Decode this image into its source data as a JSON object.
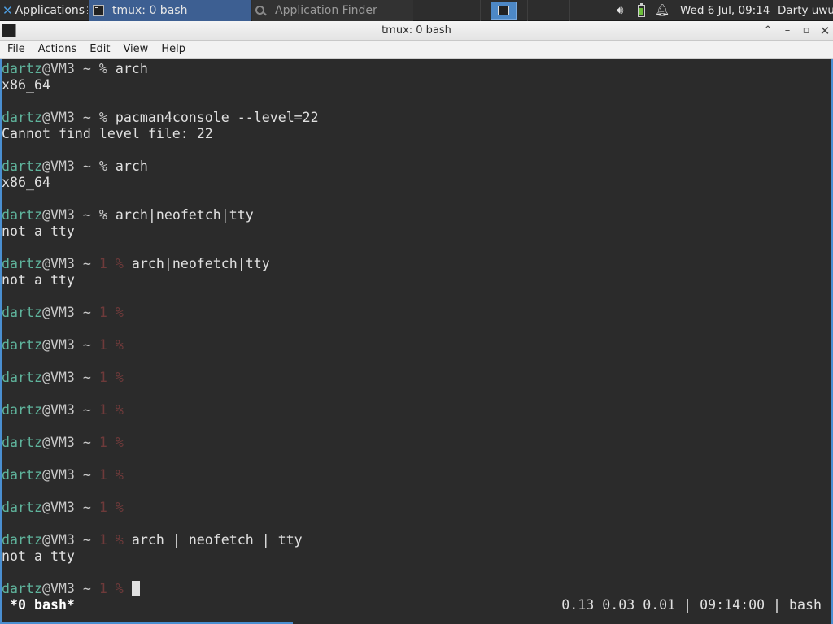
{
  "panel": {
    "applications_label": "Applications",
    "tasks": [
      {
        "label": "tmux: 0 bash"
      },
      {
        "label": "Application Finder"
      }
    ],
    "clock": "Wed  6 Jul, 09:14",
    "user": "Darty uwu"
  },
  "window": {
    "title": "tmux: 0 bash"
  },
  "menu": [
    "File",
    "Actions",
    "Edit",
    "View",
    "Help"
  ],
  "terminal": {
    "prompt_user": "dartz",
    "prompt_host": "@VM3 ~",
    "lines": [
      {
        "user": "dartz",
        "host": "@VM3 ~",
        "status": "%",
        "cmd": " arch",
        "out": "x86_64"
      },
      {
        "user": "dartz",
        "host": "@VM3 ~",
        "status": "%",
        "cmd": " pacman4console --level=22",
        "out": "Cannot find level file: 22"
      },
      {
        "user": "dartz",
        "host": "@VM3 ~",
        "status": "%",
        "cmd": " arch",
        "out": "x86_64"
      },
      {
        "user": "dartz",
        "host": "@VM3 ~",
        "status": "%",
        "cmd": " arch|neofetch|tty",
        "out": "not a tty"
      },
      {
        "user": "dartz",
        "host": "@VM3 ~",
        "status": "1 %",
        "cmd": " arch|neofetch|tty",
        "out": "not a tty"
      },
      {
        "user": "dartz",
        "host": "@VM3 ~",
        "status": "1 %",
        "cmd": "",
        "out": ""
      },
      {
        "user": "dartz",
        "host": "@VM3 ~",
        "status": "1 %",
        "cmd": "",
        "out": ""
      },
      {
        "user": "dartz",
        "host": "@VM3 ~",
        "status": "1 %",
        "cmd": "",
        "out": ""
      },
      {
        "user": "dartz",
        "host": "@VM3 ~",
        "status": "1 %",
        "cmd": "",
        "out": ""
      },
      {
        "user": "dartz",
        "host": "@VM3 ~",
        "status": "1 %",
        "cmd": "",
        "out": ""
      },
      {
        "user": "dartz",
        "host": "@VM3 ~",
        "status": "1 %",
        "cmd": "",
        "out": ""
      },
      {
        "user": "dartz",
        "host": "@VM3 ~",
        "status": "1 %",
        "cmd": "",
        "out": ""
      },
      {
        "user": "dartz",
        "host": "@VM3 ~",
        "status": "1 %",
        "cmd": " arch | neofetch | tty",
        "out": "not a tty"
      },
      {
        "user": "dartz",
        "host": "@VM3 ~",
        "status": "1 %",
        "cmd": " ",
        "out": "",
        "cursor": true
      }
    ],
    "status_left": "*0 bash*",
    "status_right": "0.13 0.03 0.01 | 09:14:00 | bash"
  },
  "colors": {
    "prompt_user": "#5fb49c",
    "error_status": "#6e3a3a",
    "terminal_bg": "#2b2b2b",
    "accent": "#4a8fd1"
  },
  "icons": {
    "applications": "xfce-x-icon",
    "task_tmux": "terminal-icon",
    "task_finder": "search-icon",
    "workspace": "workspace-switcher-icon",
    "volume": "volume-icon",
    "battery": "battery-icon",
    "notifications": "bell-icon"
  }
}
